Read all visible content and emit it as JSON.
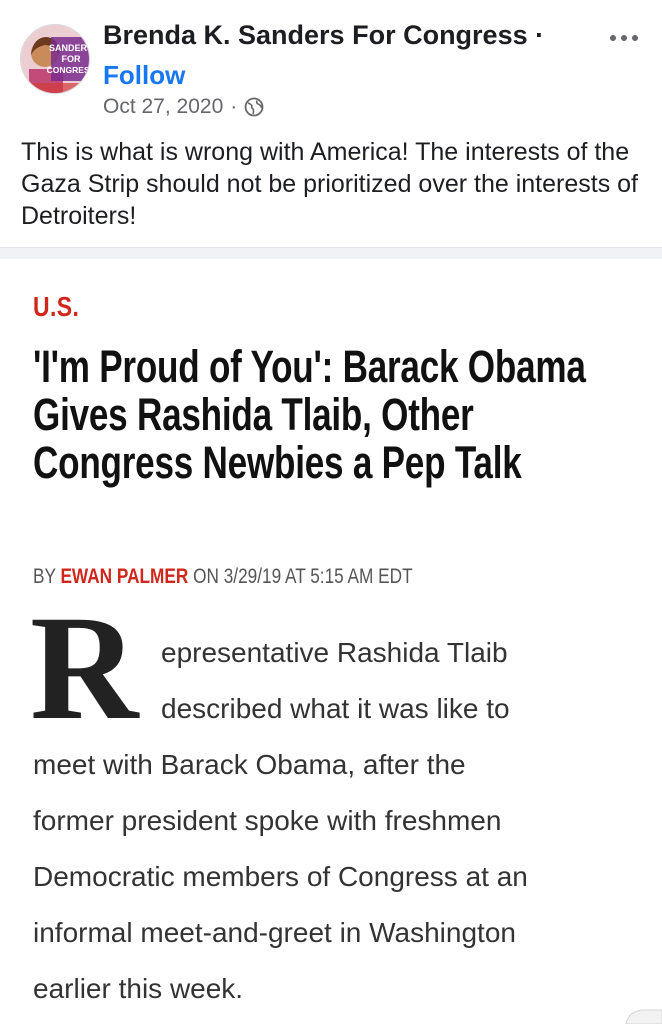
{
  "post": {
    "page_name": "Brenda K. Sanders For Congress ·",
    "follow_label": "Follow",
    "date": "Oct 27, 2020",
    "meta_sep": "·",
    "avatar_text": [
      "SANDERS",
      "FOR",
      "CONGRESS"
    ],
    "caption": "This is what is wrong with America!  The interests of the Gaza Strip should not be prioritized over the interests of Detroiters!",
    "more_icon": "more-horizontal-icon",
    "privacy_icon": "globe-icon"
  },
  "article": {
    "section": "U.S.",
    "headline": "'I'm Proud of You': Barack Obama Gives Rashida Tlaib, Other Congress Newbies a Pep Talk",
    "byline_prefix": "BY ",
    "author": "EWAN PALMER",
    "byline_suffix": " ON 3/29/19 AT 5:15 AM EDT",
    "dropcap": "R",
    "body_lines": [
      "epresentative Rashida Tlaib",
      "described what it was like to",
      "meet with Barack Obama, after the",
      "former president spoke with freshmen",
      "Democratic members of Congress at an",
      "informal meet-and-greet in Washington",
      "earlier this week."
    ]
  },
  "colors": {
    "accent": "#1877f2",
    "section_red": "#d0271d",
    "meta_gray": "#65676b"
  }
}
